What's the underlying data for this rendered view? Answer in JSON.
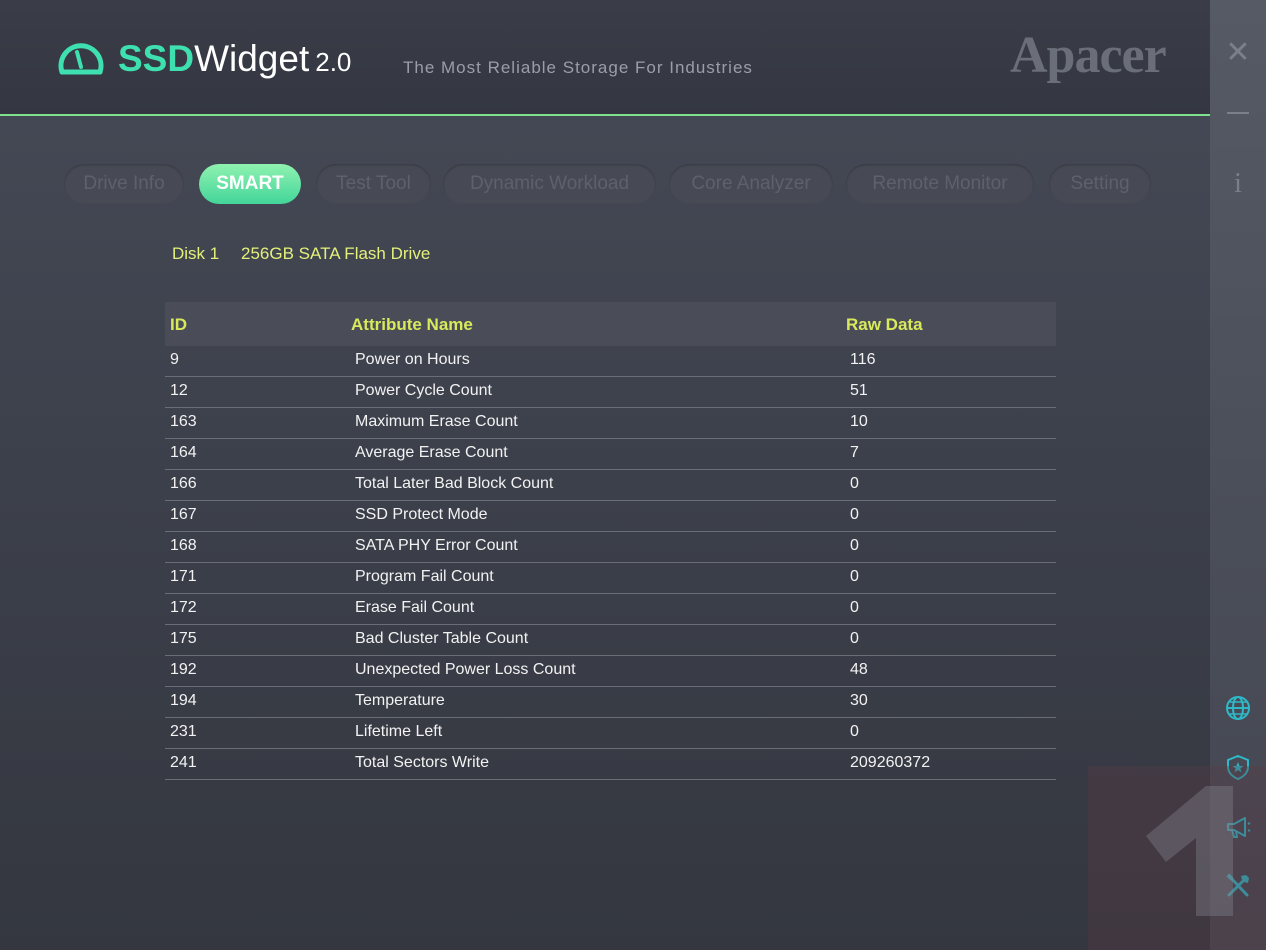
{
  "header": {
    "brand_bold": "SSD",
    "brand_rest": "Widget",
    "brand_version": "2.0",
    "tagline": "The Most Reliable Storage For Industries",
    "company": "Apacer"
  },
  "window_controls": {
    "close_glyph": "✕",
    "info_glyph": "i"
  },
  "tabs": [
    {
      "label": "Drive Info",
      "active": false
    },
    {
      "label": "SMART",
      "active": true
    },
    {
      "label": "Test Tool",
      "active": false
    },
    {
      "label": "Dynamic Workload",
      "active": false
    },
    {
      "label": "Core Analyzer",
      "active": false
    },
    {
      "label": "Remote Monitor",
      "active": false
    },
    {
      "label": "Setting",
      "active": false
    }
  ],
  "disk": {
    "name": "Disk 1",
    "model": "256GB SATA Flash Drive"
  },
  "table": {
    "columns": [
      "ID",
      "Attribute Name",
      "Raw Data"
    ],
    "rows": [
      [
        "9",
        "Power on Hours",
        "116"
      ],
      [
        "12",
        "Power Cycle Count",
        "51"
      ],
      [
        "163",
        "Maximum Erase Count",
        "10"
      ],
      [
        "164",
        "Average Erase Count",
        "7"
      ],
      [
        "166",
        "Total Later Bad Block Count",
        "0"
      ],
      [
        "167",
        "SSD Protect Mode",
        "0"
      ],
      [
        "168",
        "SATA PHY Error Count",
        "0"
      ],
      [
        "171",
        "Program Fail Count",
        "0"
      ],
      [
        "172",
        "Erase Fail Count",
        "0"
      ],
      [
        "175",
        "Bad Cluster Table Count",
        "0"
      ],
      [
        "192",
        "Unexpected Power Loss Count",
        "48"
      ],
      [
        "194",
        "Temperature",
        "30"
      ],
      [
        "231",
        "Lifetime Left",
        "0"
      ],
      [
        "241",
        "Total Sectors Write",
        "209260372"
      ]
    ]
  },
  "side_icons": [
    "globe-icon",
    "shield-icon",
    "megaphone-icon",
    "tools-icon"
  ],
  "colors": {
    "accent": "#3fe0b0",
    "header_text": "#d8ea5c",
    "tab_active": "#5ee0a4"
  }
}
